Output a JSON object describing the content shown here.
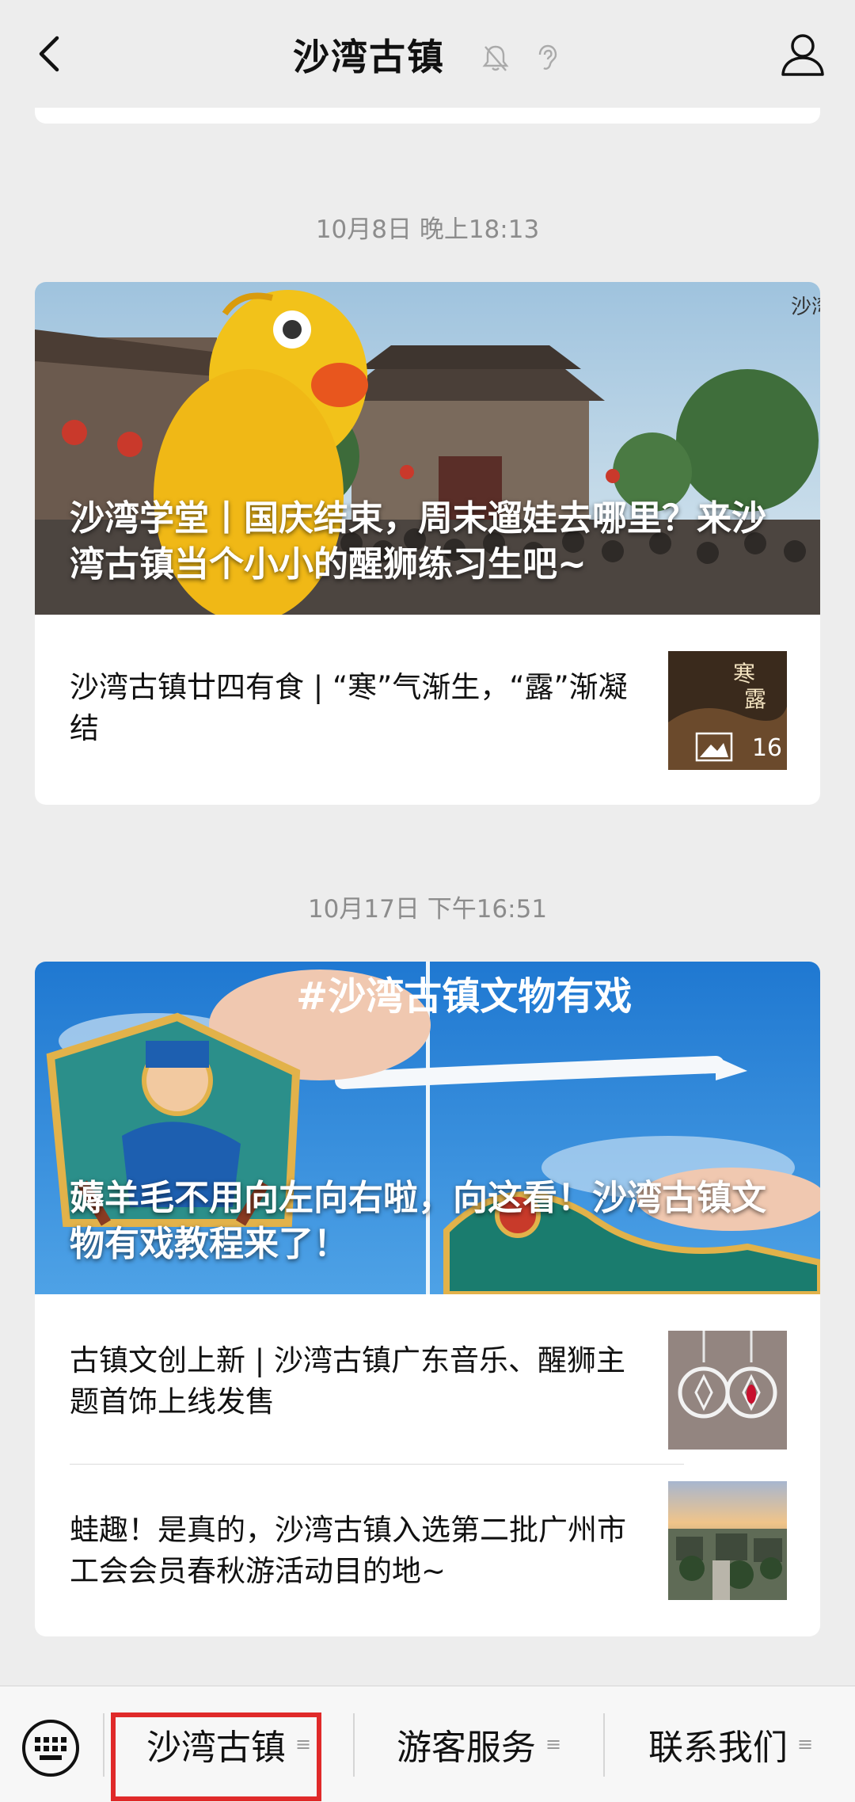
{
  "header": {
    "title": "沙湾古镇",
    "back_icon": "chevron-left-icon",
    "profile_icon": "person-icon",
    "mute_icons": [
      "bell-off-icon",
      "ear-icon"
    ]
  },
  "messages": [
    {
      "time": "10月8日 晚上18:13",
      "lead_article": {
        "title": "沙湾学堂丨国庆结束，周末遛娃去哪里？来沙湾古镇当个小小的醒狮练习生吧~",
        "watermark": "沙湾"
      },
      "items": [
        {
          "title": "沙湾古镇廿四有食 | “寒”气渐生，“露”渐凝结",
          "thumb_text": "寒露",
          "badge": "16"
        }
      ]
    },
    {
      "time": "10月17日 下午16:51",
      "lead_article": {
        "title": "薅羊毛不用向左向右啦，向这看！沙湾古镇文物有戏教程来了！",
        "banner_text": "#沙湾古镇文物有戏"
      },
      "items": [
        {
          "title": "古镇文创上新 | 沙湾古镇广东音乐、醒狮主题首饰上线发售"
        },
        {
          "title": "蛙趣！是真的，沙湾古镇入选第二批广州市工会会员春秋游活动目的地~"
        }
      ]
    }
  ],
  "bottom_menu": {
    "keyboard_icon": "keyboard-icon",
    "items": [
      {
        "label": "沙湾古镇",
        "highlighted": true
      },
      {
        "label": "游客服务"
      },
      {
        "label": "联系我们"
      }
    ],
    "lines_glyph": "≡",
    "highlight_color": "#e02a2a"
  }
}
